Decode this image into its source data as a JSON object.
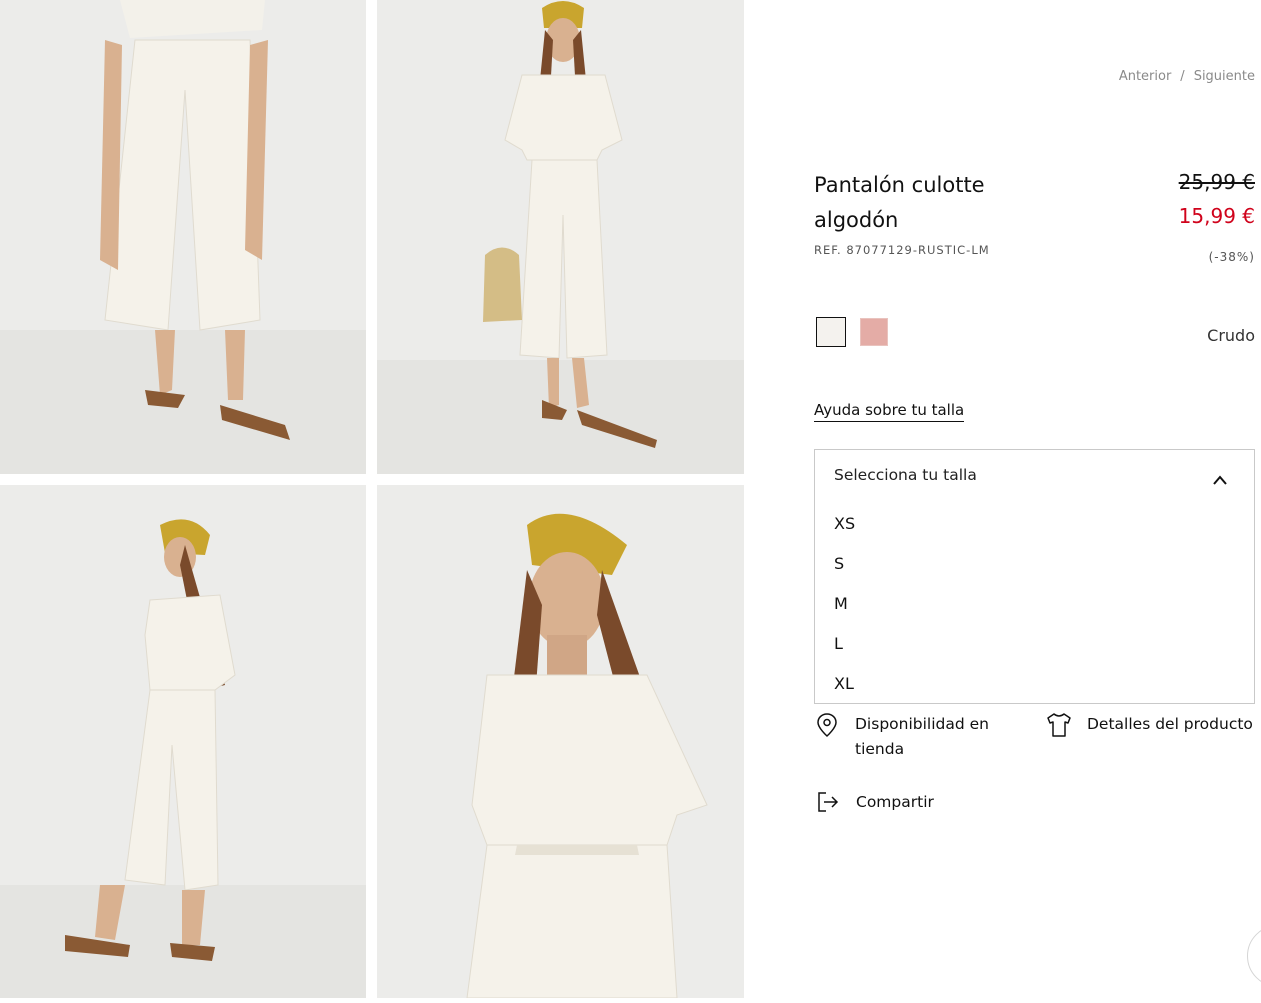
{
  "gallery": {
    "colors": {
      "backdrop": "#ececea",
      "floor": "#e3e3e0",
      "garment": "#f5f2ea",
      "skin": "#d9b190",
      "hair": "#7a4a2b",
      "scarf": "#c9a52e",
      "sandal": "#7a5a34"
    }
  },
  "nav": {
    "previous": "Anterior",
    "separator": "/",
    "next": "Siguiente"
  },
  "product": {
    "name": "Pantalón culotte algodón",
    "reference": "REF. 87077129-RUSTIC-LM",
    "old_price": "25,99 €",
    "price": "15,99 €",
    "discount": "(-38%)",
    "price_color": "#d0021b"
  },
  "colors": {
    "selected_name": "Crudo",
    "swatches": [
      {
        "hex": "#f4f2ee",
        "selected": true
      },
      {
        "hex": "#e4aca6",
        "selected": false
      }
    ]
  },
  "size_help": "Ayuda sobre tu talla",
  "size_select": {
    "placeholder": "Selecciona tu talla",
    "expanded": true,
    "options": [
      "XS",
      "S",
      "M",
      "L",
      "XL"
    ]
  },
  "actions": {
    "store_availability": "Disponibilidad en tienda",
    "product_details": "Detalles del producto",
    "share": "Compartir"
  },
  "icons": {
    "store": "location-pin-icon",
    "details": "tshirt-icon",
    "share": "share-exit-icon",
    "dropdown": "chevron-up-icon"
  }
}
